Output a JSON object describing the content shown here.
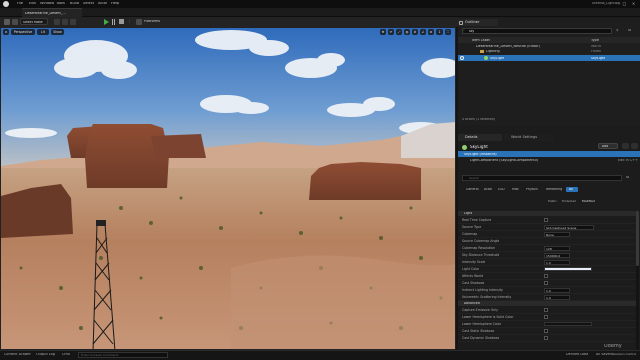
{
  "menu": {
    "items": [
      "File",
      "Edit",
      "Window",
      "Tools",
      "Build",
      "Select",
      "Actor",
      "Help"
    ],
    "app_title": "UMedia_Lighting"
  },
  "project_tab": {
    "label": "DesertMarine_Desert_..."
  },
  "toolbar": {
    "select_mode": "Select Mode",
    "platforms": "Platforms"
  },
  "viewport": {
    "perspective": "Perspective",
    "lit": "Lit",
    "show": "Show",
    "scalability_value": "1"
  },
  "outliner": {
    "tab": "Outliner",
    "search_placeholder": "Search...",
    "search_value": "sky",
    "col_item_label": "Item Label",
    "col_type": "Type",
    "rows": [
      {
        "label": "DesertMarine_Desert_Neutral (Editor)",
        "type": "World"
      },
      {
        "label": "Lighting",
        "type": "Folder"
      },
      {
        "label": "SkyLight",
        "type": "SkyLight"
      }
    ],
    "status": "4 actors (1 selected)"
  },
  "details": {
    "tabs": [
      "Details",
      "World Settings"
    ],
    "actor_name": "SkyLight",
    "add_label": "Add",
    "components": [
      "SkyLight (Instance)",
      "LightComponent (SkyLightComponent0)"
    ],
    "edit_in_cpp": "Edit in C++",
    "search_placeholder": "Search",
    "filter_tabs": [
      "General",
      "Actor",
      "LOD",
      "Misc",
      "Physics",
      "Rendering",
      "All"
    ],
    "sub_tabs": [
      "Public",
      "Protected",
      "Modified"
    ],
    "sections": [
      {
        "title": "Light",
        "props": [
          {
            "label": "Real Time Capture",
            "value": "",
            "kind": "check"
          },
          {
            "label": "Source Type",
            "value": "SLS Captured Scene",
            "kind": "field"
          },
          {
            "label": "Cubemap",
            "value": "None",
            "kind": "field"
          },
          {
            "label": "Source Cubemap Angle",
            "value": "",
            "kind": "none"
          },
          {
            "label": "Cubemap Resolution",
            "value": "128",
            "kind": "field"
          },
          {
            "label": "Sky Distance Threshold",
            "value": "150000.0",
            "kind": "field"
          },
          {
            "label": "Intensity Scale",
            "value": "1.0",
            "kind": "field"
          },
          {
            "label": "Light Color",
            "value": "",
            "kind": "color"
          },
          {
            "label": "Affects World",
            "value": "",
            "kind": "check"
          },
          {
            "label": "Cast Shadows",
            "value": "",
            "kind": "check"
          },
          {
            "label": "Indirect Lighting Intensity",
            "value": "1.0",
            "kind": "field"
          },
          {
            "label": "Volumetric Scattering Intensity",
            "value": "1.0",
            "kind": "field"
          }
        ]
      },
      {
        "title": "Advanced",
        "props": [
          {
            "label": "Capture Emissive Only",
            "value": "",
            "kind": "check"
          },
          {
            "label": "Lower Hemisphere Is Solid Color",
            "value": "",
            "kind": "check"
          },
          {
            "label": "Lower Hemisphere Color",
            "value": "",
            "kind": "color-dark"
          },
          {
            "label": "Cast Static Shadows",
            "value": "",
            "kind": "check"
          },
          {
            "label": "Cast Dynamic Shadows",
            "value": "",
            "kind": "check"
          }
        ]
      }
    ]
  },
  "statusbar": {
    "content_drawer": "Content Drawer",
    "output_log": "Output Log",
    "cmd": "Cmd",
    "console_placeholder": "Enter Console Command",
    "derived_data": "Derived Data",
    "all_saved": "All Saved",
    "revision_control": "Revision Control"
  },
  "watermark": "Udemy",
  "colors": {
    "accent": "#2a73b8",
    "play": "#3cb043",
    "sky_top": "#3c78c2",
    "sand": "#b87d58",
    "panel": "#1c1c1c"
  }
}
